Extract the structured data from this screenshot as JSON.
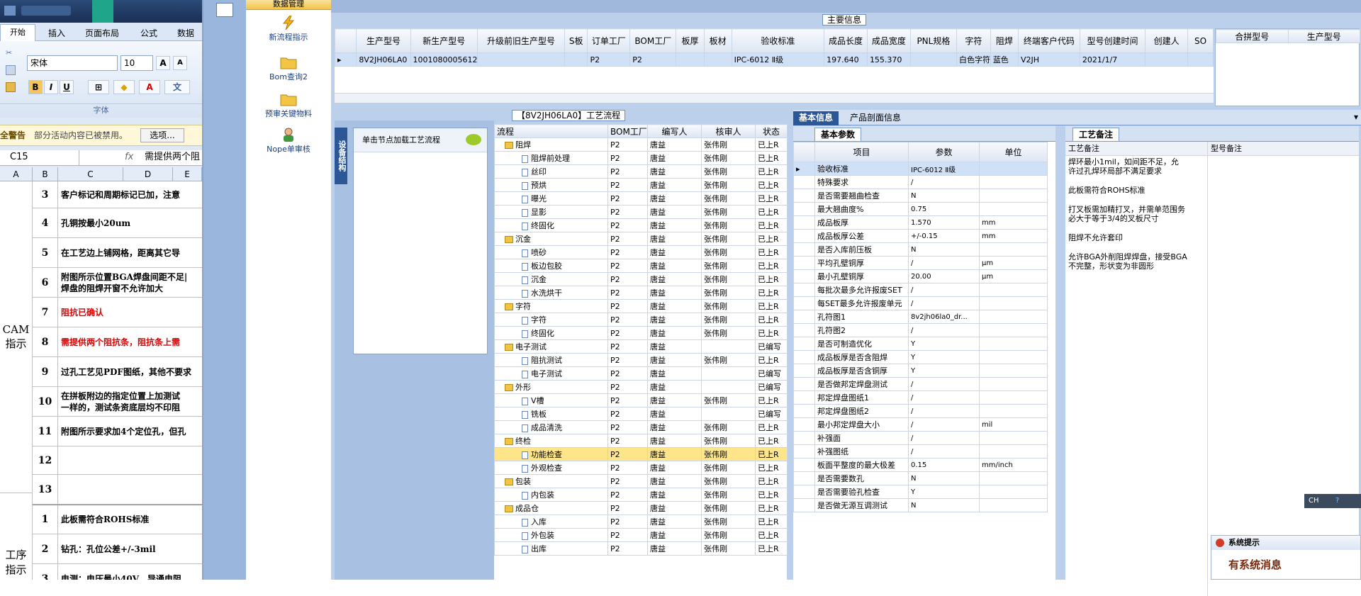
{
  "excel": {
    "tabs": [
      "开始",
      "插入",
      "页面布局",
      "公式",
      "数据"
    ],
    "font_name": "宋体",
    "font_size": "10",
    "bold": "B",
    "italic": "I",
    "underline": "U",
    "group_label": "字体",
    "warn_label": "全警告",
    "warn_text": "部分活动内容已被禁用。",
    "options_btn": "选项...",
    "cell_ref": "C15",
    "formula": "需提供两个阻",
    "cols": [
      "A",
      "B",
      "C",
      "D",
      "E"
    ],
    "group1": "CAM\n指示",
    "group2": "工序\n指示",
    "rows": [
      {
        "n": "3",
        "t": "客户标记和周期标记已加，注意",
        "c": "#000"
      },
      {
        "n": "4",
        "t": "孔铜按最小20um",
        "c": "#000"
      },
      {
        "n": "5",
        "t": "在工艺边上铺网格，距离其它导",
        "c": "#000"
      },
      {
        "n": "6",
        "t": "附图所示位置BGA焊盘间距不足|\n焊盘的阻焊开窗不允许加大",
        "c": "#000"
      },
      {
        "n": "7",
        "t": "阻抗已确认",
        "c": "#e00000"
      },
      {
        "n": "8",
        "t": "需提供两个阻抗条，阻抗条上需",
        "c": "#e00000"
      },
      {
        "n": "9",
        "t": "过孔工艺见PDF图纸，其他不要求",
        "c": "#000"
      },
      {
        "n": "10",
        "t": "在拼板附边的指定位置上加测试\n一样的，测试条资底层均不印阻",
        "c": "#000"
      },
      {
        "n": "11",
        "t": "附图所示要求加4个定位孔，但孔",
        "c": "#000"
      },
      {
        "n": "12",
        "t": "",
        "c": "#000"
      },
      {
        "n": "13",
        "t": "",
        "c": "#000"
      },
      {
        "n": "1",
        "t": "此板需符合ROHS标准",
        "c": "#000"
      },
      {
        "n": "2",
        "t": "钻孔：孔位公差+/-3mil",
        "c": "#000"
      },
      {
        "n": "3",
        "t": "电测：电压最小40V，导通电阻",
        "c": "#000"
      }
    ]
  },
  "nav": {
    "header": "数据管理",
    "items": [
      {
        "label": "新流程指示",
        "icon": "lightning-icon"
      },
      {
        "label": "Bom查询2",
        "icon": "folder-icon"
      },
      {
        "label": "预审关键物料",
        "icon": "folder-icon"
      },
      {
        "label": "Nope单审核",
        "icon": "user-icon"
      }
    ]
  },
  "main_info": {
    "title": "主要信息",
    "headers": [
      "生产型号",
      "新生产型号",
      "升级前旧生产型号",
      "S板",
      "订单工厂",
      "BOM工厂",
      "板厚",
      "板材",
      "验收标准",
      "成品长度",
      "成品宽度",
      "PNL规格",
      "字符",
      "阻焊",
      "终端客户代码",
      "型号创建时间",
      "创建人",
      "SO"
    ],
    "row": [
      "8V2JH06LA0",
      "10010800056129",
      "",
      "",
      "P2",
      "P2",
      "",
      "",
      "IPC-6012 Ⅱ级",
      "197.640",
      "155.370",
      "",
      "白色字符",
      "蓝色",
      "V2JH",
      "2021/1/7",
      "",
      ""
    ],
    "merge_headers": [
      "合拼型号",
      "生产型号"
    ]
  },
  "process": {
    "title": "【8V2JH06LA0】工艺流程",
    "side_tab": "设备结构",
    "hint": "单击节点加载工艺流程",
    "headers": [
      "流程",
      "BOM工厂",
      "编写人",
      "核审人",
      "状态"
    ],
    "rows": [
      {
        "lvl": 0,
        "n": "阻焊",
        "f": "P2",
        "w": "唐益",
        "r": "张伟刚",
        "s": "已上R"
      },
      {
        "lvl": 1,
        "n": "阻焊前处理",
        "f": "P2",
        "w": "唐益",
        "r": "张伟刚",
        "s": "已上R"
      },
      {
        "lvl": 1,
        "n": "丝印",
        "f": "P2",
        "w": "唐益",
        "r": "张伟刚",
        "s": "已上R"
      },
      {
        "lvl": 1,
        "n": "预烘",
        "f": "P2",
        "w": "唐益",
        "r": "张伟刚",
        "s": "已上R"
      },
      {
        "lvl": 1,
        "n": "曝光",
        "f": "P2",
        "w": "唐益",
        "r": "张伟刚",
        "s": "已上R"
      },
      {
        "lvl": 1,
        "n": "显影",
        "f": "P2",
        "w": "唐益",
        "r": "张伟刚",
        "s": "已上R"
      },
      {
        "lvl": 1,
        "n": "终固化",
        "f": "P2",
        "w": "唐益",
        "r": "张伟刚",
        "s": "已上R"
      },
      {
        "lvl": 0,
        "n": "沉金",
        "f": "P2",
        "w": "唐益",
        "r": "张伟刚",
        "s": "已上R"
      },
      {
        "lvl": 1,
        "n": "喷砂",
        "f": "P2",
        "w": "唐益",
        "r": "张伟刚",
        "s": "已上R"
      },
      {
        "lvl": 1,
        "n": "板边包胶",
        "f": "P2",
        "w": "唐益",
        "r": "张伟刚",
        "s": "已上R"
      },
      {
        "lvl": 1,
        "n": "沉金",
        "f": "P2",
        "w": "唐益",
        "r": "张伟刚",
        "s": "已上R"
      },
      {
        "lvl": 1,
        "n": "水洗烘干",
        "f": "P2",
        "w": "唐益",
        "r": "张伟刚",
        "s": "已上R"
      },
      {
        "lvl": 0,
        "n": "字符",
        "f": "P2",
        "w": "唐益",
        "r": "张伟刚",
        "s": "已上R"
      },
      {
        "lvl": 1,
        "n": "字符",
        "f": "P2",
        "w": "唐益",
        "r": "张伟刚",
        "s": "已上R"
      },
      {
        "lvl": 1,
        "n": "终固化",
        "f": "P2",
        "w": "唐益",
        "r": "张伟刚",
        "s": "已上R"
      },
      {
        "lvl": 0,
        "n": "电子测试",
        "f": "P2",
        "w": "唐益",
        "r": "",
        "s": "已编写"
      },
      {
        "lvl": 1,
        "n": "阻抗测试",
        "f": "P2",
        "w": "唐益",
        "r": "张伟刚",
        "s": "已上R"
      },
      {
        "lvl": 1,
        "n": "电子测试",
        "f": "P2",
        "w": "唐益",
        "r": "",
        "s": "已编写"
      },
      {
        "lvl": 0,
        "n": "外形",
        "f": "P2",
        "w": "唐益",
        "r": "",
        "s": "已编写"
      },
      {
        "lvl": 1,
        "n": "V槽",
        "f": "P2",
        "w": "唐益",
        "r": "张伟刚",
        "s": "已上R"
      },
      {
        "lvl": 1,
        "n": "铣板",
        "f": "P2",
        "w": "唐益",
        "r": "",
        "s": "已编写"
      },
      {
        "lvl": 1,
        "n": "成品清洗",
        "f": "P2",
        "w": "唐益",
        "r": "张伟刚",
        "s": "已上R"
      },
      {
        "lvl": 0,
        "n": "终检",
        "f": "P2",
        "w": "唐益",
        "r": "张伟刚",
        "s": "已上R"
      },
      {
        "lvl": 1,
        "n": "功能检查",
        "f": "P2",
        "w": "唐益",
        "r": "张伟刚",
        "s": "已上R",
        "sel": true
      },
      {
        "lvl": 1,
        "n": "外观检查",
        "f": "P2",
        "w": "唐益",
        "r": "张伟刚",
        "s": "已上R"
      },
      {
        "lvl": 0,
        "n": "包装",
        "f": "P2",
        "w": "唐益",
        "r": "张伟刚",
        "s": "已上R"
      },
      {
        "lvl": 1,
        "n": "内包装",
        "f": "P2",
        "w": "唐益",
        "r": "张伟刚",
        "s": "已上R"
      },
      {
        "lvl": 0,
        "n": "成品仓",
        "f": "P2",
        "w": "唐益",
        "r": "张伟刚",
        "s": "已上R"
      },
      {
        "lvl": 1,
        "n": "入库",
        "f": "P2",
        "w": "唐益",
        "r": "张伟刚",
        "s": "已上R"
      },
      {
        "lvl": 1,
        "n": "外包装",
        "f": "P2",
        "w": "唐益",
        "r": "张伟刚",
        "s": "已上R"
      },
      {
        "lvl": 1,
        "n": "出库",
        "f": "P2",
        "w": "唐益",
        "r": "张伟刚",
        "s": "已上R"
      }
    ]
  },
  "basic": {
    "tabs": [
      "基本信息",
      "产品剖面信息"
    ],
    "sub_tab": "基本参数",
    "headers": [
      "项目",
      "参数",
      "单位"
    ],
    "rows": [
      [
        "验收标准",
        "IPC-6012 Ⅱ级",
        ""
      ],
      [
        "特殊要求",
        "/",
        ""
      ],
      [
        "是否需要翘曲检查",
        "N",
        ""
      ],
      [
        "最大翘曲度%",
        "0.75",
        ""
      ],
      [
        "成品板厚",
        "1.570",
        "mm"
      ],
      [
        "成品板厚公差",
        "+/-0.15",
        "mm"
      ],
      [
        "是否入库前压板",
        "N",
        ""
      ],
      [
        "平均孔壁铜厚",
        "/",
        "μm"
      ],
      [
        "最小孔壁铜厚",
        "20.00",
        "μm"
      ],
      [
        "每批次最多允许报废SET",
        "/",
        ""
      ],
      [
        "每SET最多允许报废单元",
        "/",
        ""
      ],
      [
        "孔符图1",
        "8v2jh06la0_dr...",
        ""
      ],
      [
        "孔符图2",
        "/",
        ""
      ],
      [
        "是否可制造优化",
        "Y",
        ""
      ],
      [
        "成品板厚是否含阻焊",
        "Y",
        ""
      ],
      [
        "成品板厚是否含铜厚",
        "Y",
        ""
      ],
      [
        "是否做邦定焊盘测试",
        "/",
        ""
      ],
      [
        "邦定焊盘图纸1",
        "/",
        ""
      ],
      [
        "邦定焊盘图纸2",
        "/",
        ""
      ],
      [
        "最小邦定焊盘大小",
        "/",
        "mil"
      ],
      [
        "补强面",
        "/",
        ""
      ],
      [
        "补强图纸",
        "/",
        ""
      ],
      [
        "板面平整度的最大极差",
        "0.15",
        "mm/inch"
      ],
      [
        "是否需要数孔",
        "N",
        ""
      ],
      [
        "是否需要验孔检查",
        "Y",
        ""
      ],
      [
        "是否做无源互调测试",
        "N",
        ""
      ]
    ]
  },
  "remark": {
    "tab": "工艺备注",
    "col1": "工艺备注",
    "col2": "型号备注",
    "lines": [
      "焊环最小1mil，如间距不足，允\n许过孔焊环局部不满足要求",
      "此板需符合ROHS标准",
      "打叉板需加精打叉，并需单范围务\n必大于等于3/4的叉板尺寸",
      "阻焊不允许套印",
      "允许BGA外削阻焊焊盘，接受BGA\n不完整，形状变为非圆形"
    ]
  },
  "sysmsg": {
    "title": "系统提示",
    "text": "有系统消息"
  },
  "tray": {
    "lang": "CH"
  }
}
